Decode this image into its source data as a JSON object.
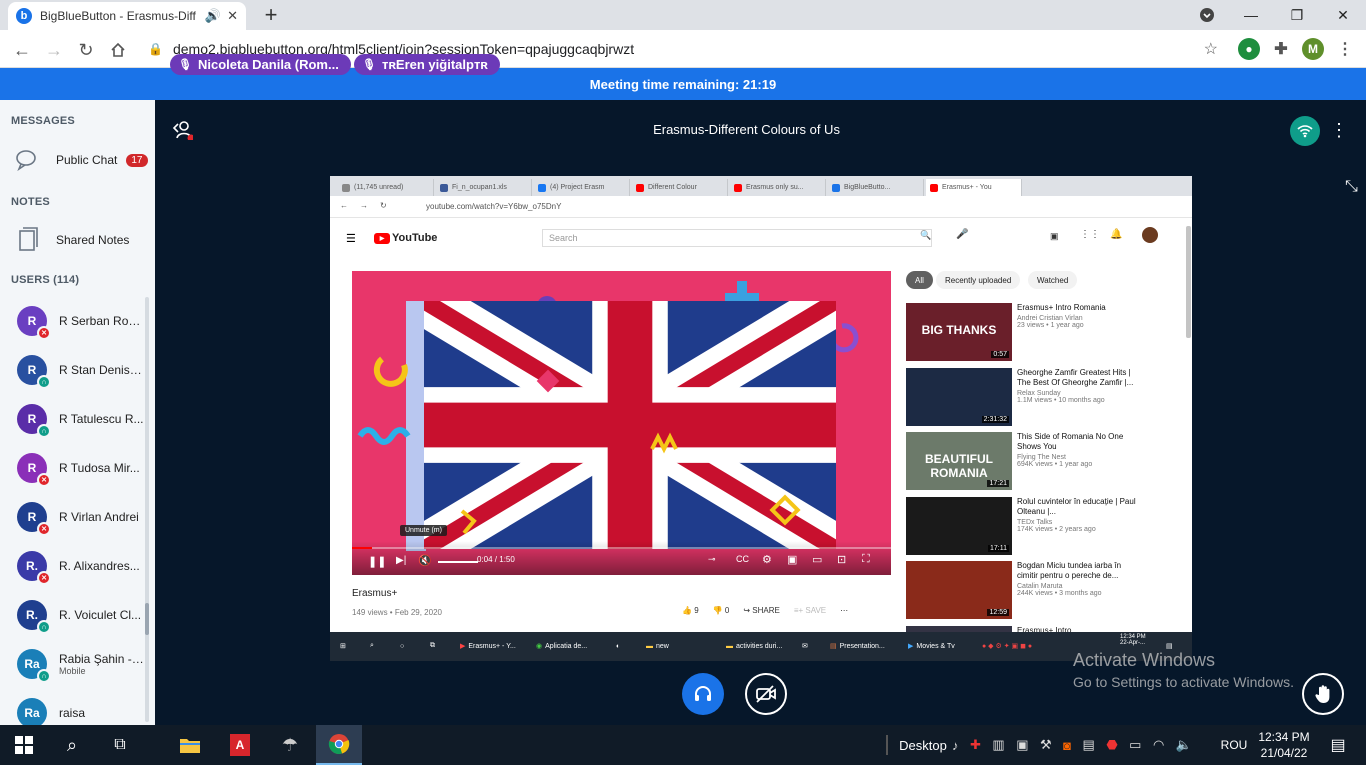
{
  "browser": {
    "tab_title": "BigBlueButton - Erasmus-Diff",
    "url": "demo2.bigbluebutton.org/html5client/join?sessionToken=qpajuggcaqbjrwzt",
    "profile_initial": "M"
  },
  "banner": {
    "text": "Meeting time remaining: 21:19"
  },
  "sidebar": {
    "messages_title": "MESSAGES",
    "public_chat_label": "Public Chat",
    "public_chat_badge": "17",
    "notes_title": "NOTES",
    "shared_notes_label": "Shared Notes",
    "users_title": "USERS (114)",
    "users": [
      {
        "initials": "R",
        "name": "R Serban Rob...",
        "color": "#6a3fc1",
        "status": "muted",
        "sub": ""
      },
      {
        "initials": "R",
        "name": "R Stan Denisa...",
        "color": "#2850a0",
        "status": "listen",
        "sub": ""
      },
      {
        "initials": "R",
        "name": "R Tatulescu R...",
        "color": "#5a2da8",
        "status": "listen",
        "sub": ""
      },
      {
        "initials": "R",
        "name": "R Tudosa Mir...",
        "color": "#8a2fb8",
        "status": "muted",
        "sub": ""
      },
      {
        "initials": "R",
        "name": "R Virlan Andrei",
        "color": "#1f3f8f",
        "status": "muted",
        "sub": ""
      },
      {
        "initials": "R.",
        "name": "R. Alixandres...",
        "color": "#3a3aa8",
        "status": "muted",
        "sub": ""
      },
      {
        "initials": "R.",
        "name": "R. Voiculet Cl...",
        "color": "#1f3f8f",
        "status": "listen",
        "sub": ""
      },
      {
        "initials": "Ra",
        "name": "Rabia Şahin -TR",
        "color": "#1a7fb8",
        "status": "listen",
        "sub": "Mobile"
      },
      {
        "initials": "Ra",
        "name": "raisa",
        "color": "#1a7fb8",
        "status": "none",
        "sub": ""
      }
    ]
  },
  "main": {
    "meeting_title": "Erasmus-Different Colours of Us",
    "talkers": [
      {
        "name": "Nicoleta Danila (Rom..."
      },
      {
        "name": "ᴛʀEren yiğitalpᴛʀ"
      }
    ]
  },
  "shared_screen": {
    "tabs": [
      "(11,745 unread)",
      "Fi_n_ocupan1.xls",
      "(4) Project Erasm",
      "Different Colour",
      "Erasmus only su...",
      "BigBlueButto...",
      "Erasmus+ - You"
    ],
    "address": "youtube.com/watch?v=Y6bw_o75DnY",
    "search_placeholder": "Search",
    "youtube_logo": "YouTube",
    "time": "0:04 / 1:50",
    "tooltip": "Unmute (m)",
    "video_title": "Erasmus+",
    "video_meta": "149 views • Feb 29, 2020",
    "likes": "9",
    "dislikes": "0",
    "share": "SHARE",
    "save": "SAVE",
    "chips": [
      "All",
      "Recently uploaded",
      "Watched"
    ],
    "recommendations": [
      {
        "title": "Erasmus+ Intro Romania",
        "channel": "Andrei Cristian Virlan",
        "stats": "23 views • 1 year ago",
        "duration": "0:57",
        "thumb_text": "BIG THANKS",
        "thumb_color": "#6a1f2a"
      },
      {
        "title": "Gheorghe Zamfir Greatest Hits | The Best Of Gheorghe Zamfir |...",
        "channel": "Relax Sunday",
        "stats": "1.1M views • 10 months ago",
        "duration": "2:31:32",
        "thumb_text": "",
        "thumb_color": "#1c2a44"
      },
      {
        "title": "This Side of Romania No One Shows You",
        "channel": "Flying The Nest",
        "stats": "694K views • 1 year ago",
        "duration": "17:21",
        "thumb_text": "BEAUTIFUL ROMANIA",
        "thumb_color": "#6c7a6a"
      },
      {
        "title": "Rolul cuvintelor în educație | Paul Olteanu |...",
        "channel": "TEDx Talks",
        "stats": "174K views • 2 years ago",
        "duration": "17:11",
        "thumb_text": "",
        "thumb_color": "#1a1a1a"
      },
      {
        "title": "Bogdan Miciu tundea iarba în cimitir pentru o pereche de...",
        "channel": "Catalin Maruta",
        "stats": "244K views • 3 months ago",
        "duration": "12:59",
        "thumb_text": "",
        "thumb_color": "#8a2a1a"
      },
      {
        "title": "Erasmus+ Intro",
        "channel": "",
        "stats": "",
        "duration": "",
        "thumb_text": "",
        "thumb_color": "#334"
      }
    ],
    "taskbar_items": [
      "Erasmus+ - Y...",
      "Aplicatia de...",
      "new",
      "activities duri...",
      "Presentation...",
      "Movies & Tv"
    ],
    "clock_time": "12:34 PM",
    "clock_date": "22-Apr-..."
  },
  "activate": {
    "line1": "Activate Windows",
    "line2": "Go to Settings to activate Windows."
  },
  "taskbar": {
    "desktop_label": "Desktop",
    "lang": "ROU",
    "time": "12:34 PM",
    "date": "21/04/22"
  }
}
